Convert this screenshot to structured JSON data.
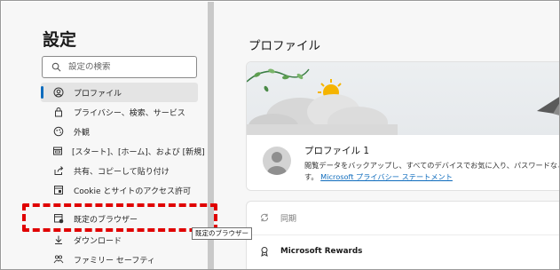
{
  "sidebar": {
    "title": "設定",
    "search": {
      "placeholder": "設定の検索"
    },
    "items": [
      {
        "label": "プロファイル",
        "icon": "profile-icon",
        "active": true
      },
      {
        "label": "プライバシー、検索、サービス",
        "icon": "lock-icon"
      },
      {
        "label": "外観",
        "icon": "appearance-icon"
      },
      {
        "label": "[スタート]、[ホーム]、および [新規] タブ",
        "icon": "start-home-icon"
      },
      {
        "label": "共有、コピーして貼り付け",
        "icon": "share-icon"
      },
      {
        "label": "Cookie とサイトのアクセス許可",
        "icon": "cookie-icon"
      },
      {
        "label": "既定のブラウザー",
        "icon": "default-browser-icon"
      },
      {
        "label": "ダウンロード",
        "icon": "download-icon"
      },
      {
        "label": "ファミリー セーフティ",
        "icon": "family-icon"
      }
    ]
  },
  "tooltip": {
    "text": "既定のブラウザー"
  },
  "main": {
    "title": "プロファイル",
    "profile": {
      "name": "プロファイル 1",
      "description": "閲覧データをバックアップし、すべてのデバイスでお気に入り、パスワードなどを表",
      "description2_prefix": "す。",
      "privacy_link": "Microsoft プライバシー ステートメント"
    },
    "rows": [
      {
        "label": "同期",
        "icon": "sync-icon"
      },
      {
        "label": "Microsoft Rewards",
        "icon": "rewards-icon"
      }
    ]
  },
  "colors": {
    "accent": "#0f6cbd",
    "highlight": "#e00000",
    "sidebar_bg": "#f7f7f7"
  }
}
